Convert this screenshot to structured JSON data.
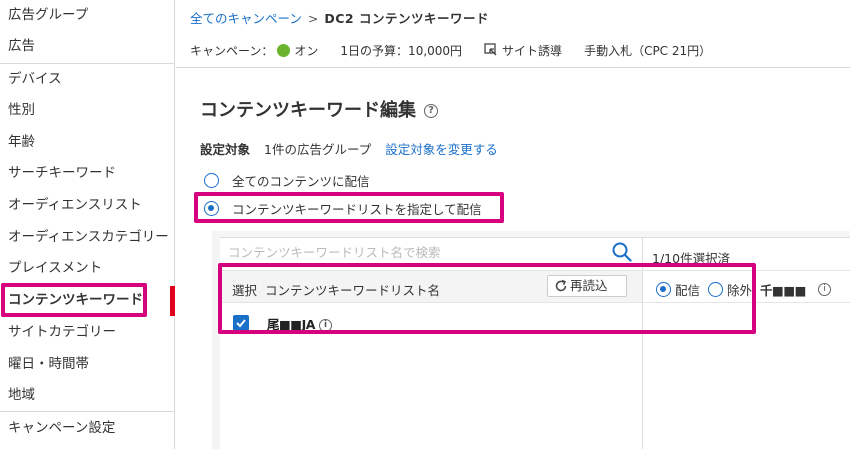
{
  "sidebar": {
    "items": [
      {
        "label": "広告グループ"
      },
      {
        "label": "広告"
      },
      {
        "label": "デバイス"
      },
      {
        "label": "性別"
      },
      {
        "label": "年齢"
      },
      {
        "label": "サーチキーワード"
      },
      {
        "label": "オーディエンスリスト"
      },
      {
        "label": "オーディエンスカテゴリー"
      },
      {
        "label": "プレイスメント"
      },
      {
        "label": "コンテンツキーワード"
      },
      {
        "label": "サイトカテゴリー"
      },
      {
        "label": "曜日・時間帯"
      },
      {
        "label": "地域"
      },
      {
        "label": "キャンペーン設定"
      }
    ],
    "active_item": "コンテンツキーワード",
    "active_color": "#e0001b",
    "highlight_color": "#d6007f"
  },
  "header": {
    "breadcrumb": {
      "root": "全てのキャンペーン",
      "separator": ">",
      "current": "DC2 コンテンツキーワード"
    },
    "campaign_label": "キャンペーン：",
    "status": "オン",
    "status_color": "#6ab42d",
    "budget": "1日の予算：10,000円",
    "goal": "サイト誘導",
    "bidding": "手動入札（CPC 21円）"
  },
  "main": {
    "title": "コンテンツキーワード編集",
    "target_label": "設定対象",
    "target_value": "1件の広告グループ",
    "change_target_link": "設定対象を変更する",
    "options": [
      {
        "label": "全てのコンテンツに配信",
        "selected": false
      },
      {
        "label": "コンテンツキーワードリストを指定して配信",
        "selected": true
      }
    ]
  },
  "list_panel": {
    "search_placeholder": "コンテンツキーワードリスト名で検索",
    "col_select": "選択",
    "col_name": "コンテンツキーワードリスト名",
    "reload_label": "再読込",
    "rows": [
      {
        "name": "尾■■JA",
        "checked": true
      }
    ],
    "selected_count": "1/10件選択済",
    "delivery_label": "配信",
    "exclude_label": "除外",
    "selected_name": "千■■■"
  },
  "accent_color": "#1a6fc9"
}
